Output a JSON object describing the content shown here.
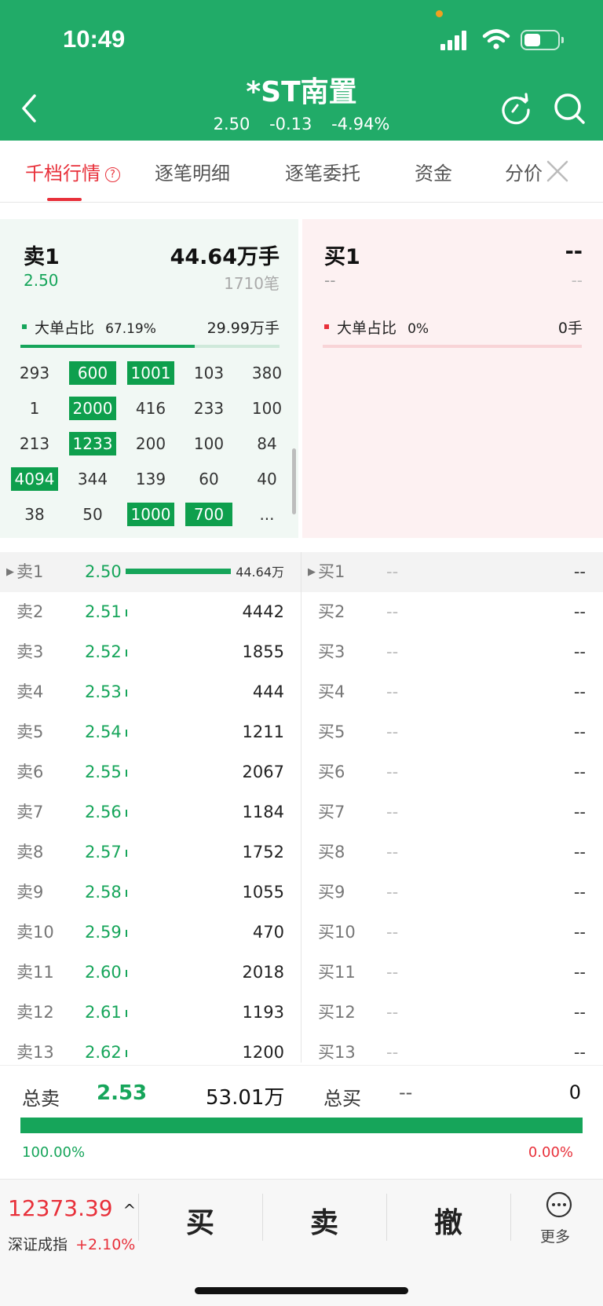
{
  "status_bar": {
    "time": "10:49"
  },
  "header": {
    "title": "*ST南置",
    "price": "2.50",
    "change": "-0.13",
    "change_pct": "-4.94%"
  },
  "tabs": [
    "千档行情",
    "逐笔明细",
    "逐笔委托",
    "资金",
    "分价"
  ],
  "help_glyph": "?",
  "sell_panel": {
    "label": "卖1",
    "price": "2.50",
    "volume": "44.64万手",
    "orders": "1710笔",
    "big_label": "大单占比",
    "big_pct": "67.19%",
    "big_pct_value": 0.6719,
    "big_volume": "29.99万手",
    "grid": [
      [
        {
          "v": "293",
          "h": false
        },
        {
          "v": "600",
          "h": true
        },
        {
          "v": "1001",
          "h": true
        },
        {
          "v": "103",
          "h": false
        },
        {
          "v": "380",
          "h": false
        }
      ],
      [
        {
          "v": "1",
          "h": false
        },
        {
          "v": "2000",
          "h": true
        },
        {
          "v": "416",
          "h": false
        },
        {
          "v": "233",
          "h": false
        },
        {
          "v": "100",
          "h": false
        }
      ],
      [
        {
          "v": "213",
          "h": false
        },
        {
          "v": "1233",
          "h": true
        },
        {
          "v": "200",
          "h": false
        },
        {
          "v": "100",
          "h": false
        },
        {
          "v": "84",
          "h": false
        }
      ],
      [
        {
          "v": "4094",
          "h": true
        },
        {
          "v": "344",
          "h": false
        },
        {
          "v": "139",
          "h": false
        },
        {
          "v": "60",
          "h": false
        },
        {
          "v": "40",
          "h": false
        }
      ],
      [
        {
          "v": "38",
          "h": false
        },
        {
          "v": "50",
          "h": false
        },
        {
          "v": "1000",
          "h": true
        },
        {
          "v": "700",
          "h": true
        },
        {
          "v": "...",
          "h": false
        }
      ]
    ]
  },
  "buy_panel": {
    "label": "买1",
    "price": "--",
    "volume": "--",
    "orders": "--",
    "big_label": "大单占比",
    "big_pct": "0%",
    "big_volume": "0手"
  },
  "order_book": {
    "sell": [
      {
        "label": "卖1",
        "price": "2.50",
        "vol": "44.64万",
        "share": 1.0
      },
      {
        "label": "卖2",
        "price": "2.51",
        "vol": "4442",
        "share": 0.01
      },
      {
        "label": "卖3",
        "price": "2.52",
        "vol": "1855",
        "share": 0.01
      },
      {
        "label": "卖4",
        "price": "2.53",
        "vol": "444",
        "share": 0.01
      },
      {
        "label": "卖5",
        "price": "2.54",
        "vol": "1211",
        "share": 0.01
      },
      {
        "label": "卖6",
        "price": "2.55",
        "vol": "2067",
        "share": 0.01
      },
      {
        "label": "卖7",
        "price": "2.56",
        "vol": "1184",
        "share": 0.01
      },
      {
        "label": "卖8",
        "price": "2.57",
        "vol": "1752",
        "share": 0.01
      },
      {
        "label": "卖9",
        "price": "2.58",
        "vol": "1055",
        "share": 0.01
      },
      {
        "label": "卖10",
        "price": "2.59",
        "vol": "470",
        "share": 0.01
      },
      {
        "label": "卖11",
        "price": "2.60",
        "vol": "2018",
        "share": 0.01
      },
      {
        "label": "卖12",
        "price": "2.61",
        "vol": "1193",
        "share": 0.01
      },
      {
        "label": "卖13",
        "price": "2.62",
        "vol": "1200",
        "share": 0.01
      }
    ],
    "buy": [
      {
        "label": "买1",
        "price": "--",
        "vol": "--"
      },
      {
        "label": "买2",
        "price": "--",
        "vol": "--"
      },
      {
        "label": "买3",
        "price": "--",
        "vol": "--"
      },
      {
        "label": "买4",
        "price": "--",
        "vol": "--"
      },
      {
        "label": "买5",
        "price": "--",
        "vol": "--"
      },
      {
        "label": "买6",
        "price": "--",
        "vol": "--"
      },
      {
        "label": "买7",
        "price": "--",
        "vol": "--"
      },
      {
        "label": "买8",
        "price": "--",
        "vol": "--"
      },
      {
        "label": "买9",
        "price": "--",
        "vol": "--"
      },
      {
        "label": "买10",
        "price": "--",
        "vol": "--"
      },
      {
        "label": "买11",
        "price": "--",
        "vol": "--"
      },
      {
        "label": "买12",
        "price": "--",
        "vol": "--"
      },
      {
        "label": "买13",
        "price": "--",
        "vol": "--"
      }
    ]
  },
  "summary": {
    "sell_label": "总卖",
    "sell_price": "2.53",
    "sell_volume": "53.01万",
    "buy_label": "总买",
    "buy_price": "--",
    "buy_volume": "0",
    "sell_pct": "100.00%",
    "buy_pct": "0.00%",
    "sell_share": 1.0
  },
  "bottom": {
    "index_value": "12373.39",
    "index_arrow": "^",
    "index_name": "深证成指",
    "index_change": "+2.10%",
    "buy": "买",
    "sell": "卖",
    "cancel": "撤",
    "more": "更多"
  },
  "colors": {
    "brand": "#21ab68",
    "up": "#e8303a",
    "down": "#16a55a",
    "highlight": "#0e9f4d"
  },
  "icons": [
    "back-icon",
    "refresh-icon",
    "search-icon",
    "close-icon",
    "more-icon",
    "signal-icon",
    "wifi-icon",
    "battery-icon"
  ]
}
